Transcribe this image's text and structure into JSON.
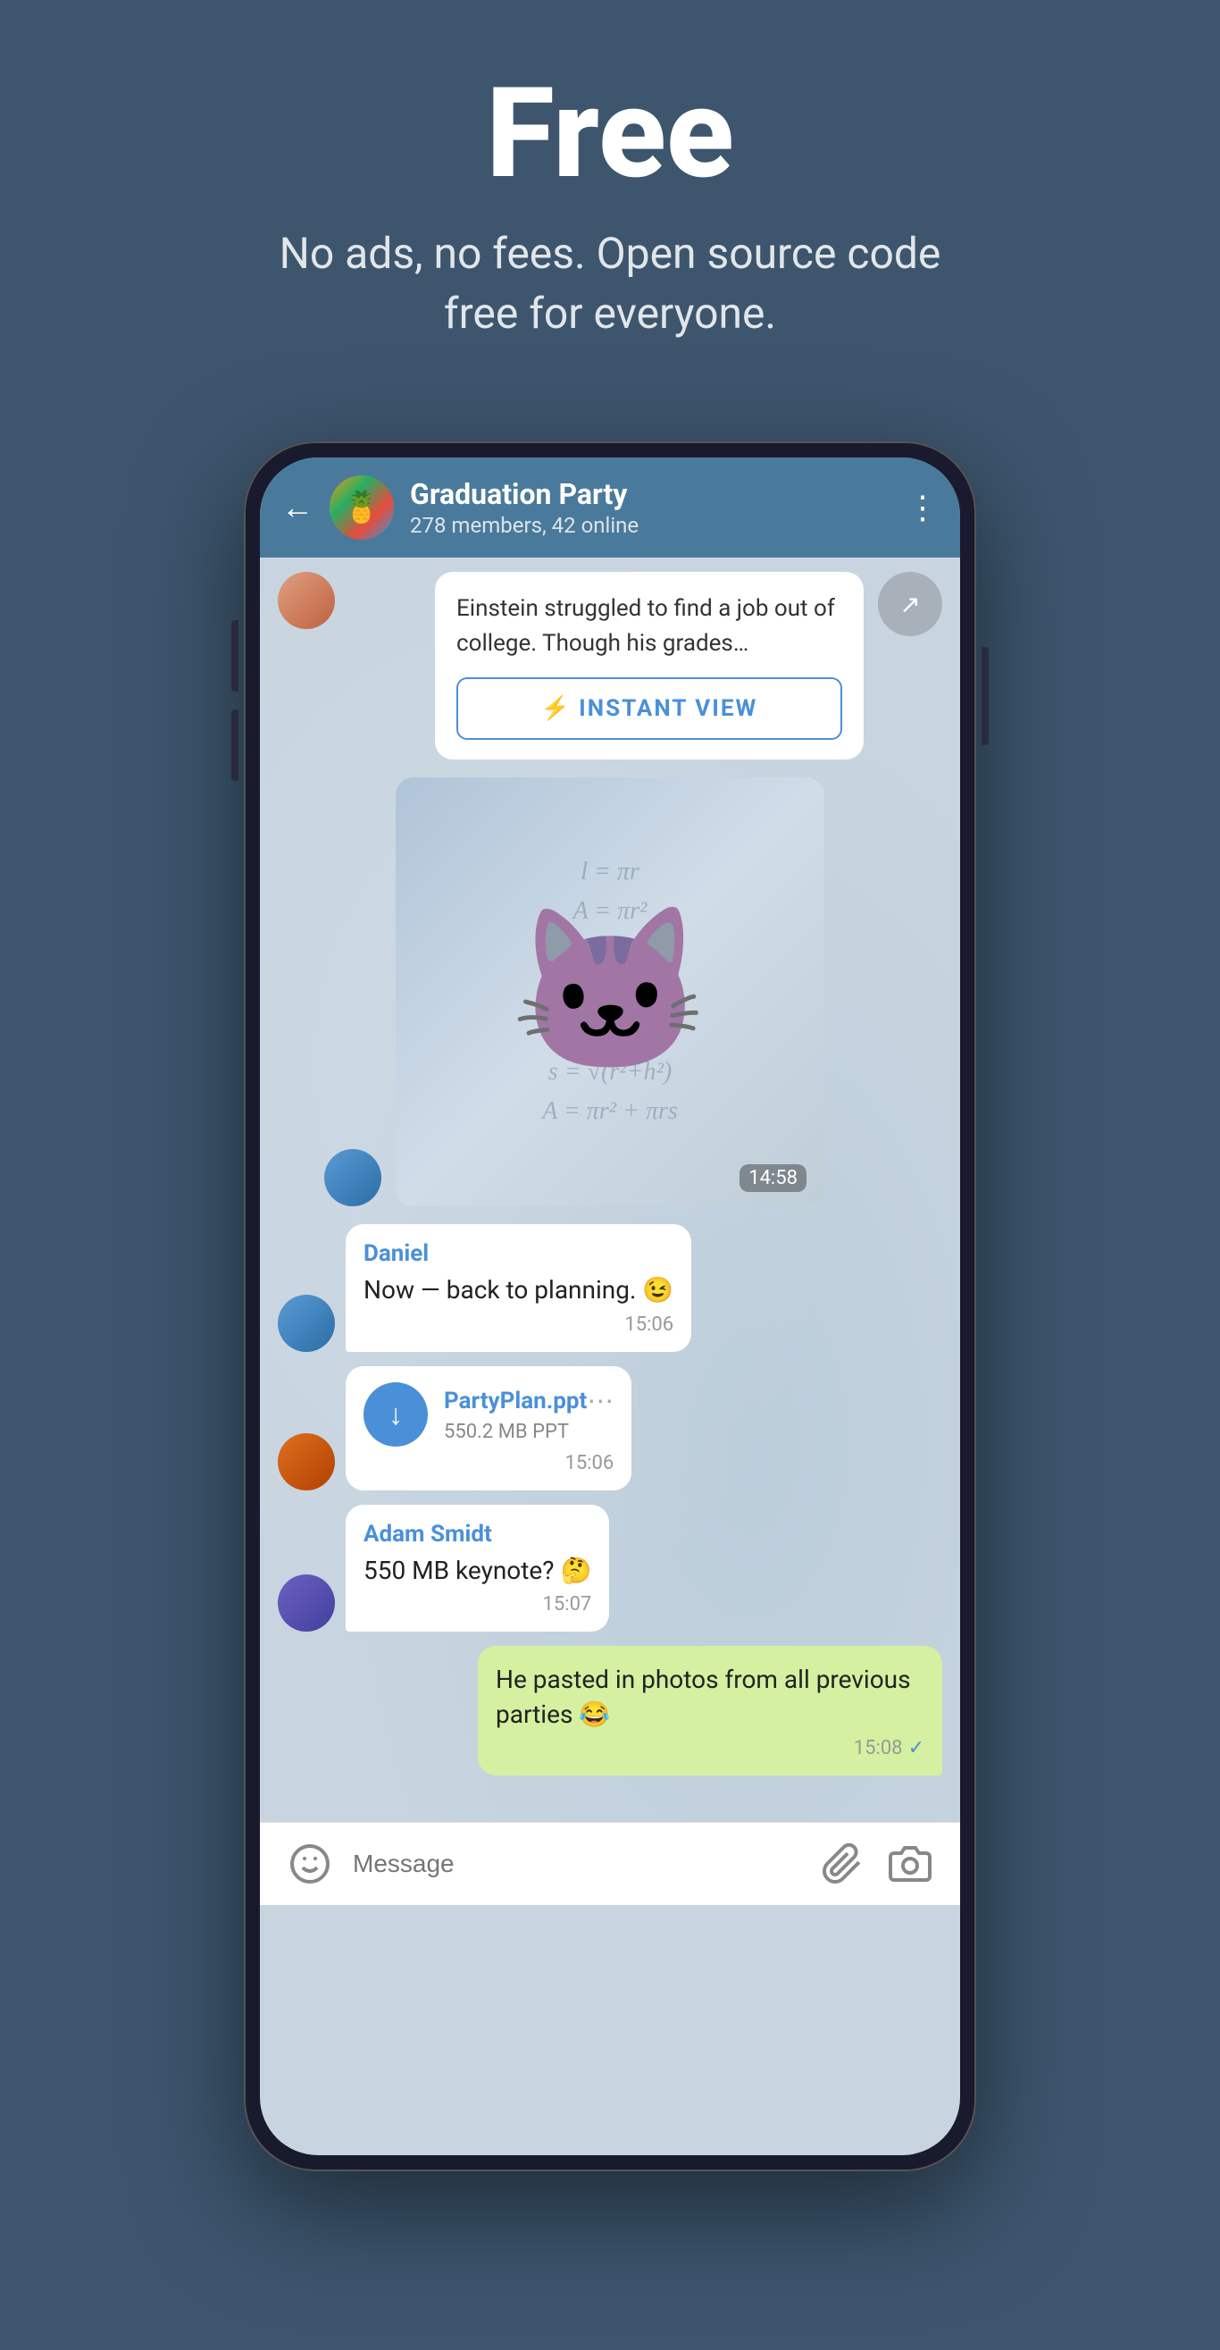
{
  "hero": {
    "title": "Free",
    "subtitle": "No ads, no fees. Open source code free for everyone."
  },
  "chat": {
    "back_label": "←",
    "group_name": "Graduation Party",
    "group_status": "278 members, 42 online",
    "article_preview": "Einstein struggled to find a job out of college. Though his grades…",
    "instant_view_label": "INSTANT VIEW",
    "sticker_time": "14:58",
    "messages": [
      {
        "id": "msg1",
        "sender": "Daniel",
        "text": "Now — back to planning. 😉",
        "time": "15:06",
        "type": "incoming",
        "avatar": "boy1"
      },
      {
        "id": "msg2",
        "sender": "",
        "type": "file",
        "file_name": "PartyPlan.ppt",
        "file_size": "550.2 MB PPT",
        "time": "15:06",
        "avatar": "boy2"
      },
      {
        "id": "msg3",
        "sender": "Adam Smidt",
        "text": "550 MB keynote? 🤔",
        "time": "15:07",
        "type": "incoming",
        "avatar": "boy3"
      },
      {
        "id": "msg4",
        "sender": "",
        "text": "He pasted in photos from all previous parties 😂",
        "time": "15:08",
        "type": "outgoing",
        "check": "✓"
      }
    ],
    "input_placeholder": "Message",
    "math_formulas": "l = πr\nA = πr²\nV = l³\nP = 2πr\nA = πr²\ns = √(r²+h²)\nA = πr² + πrs"
  }
}
